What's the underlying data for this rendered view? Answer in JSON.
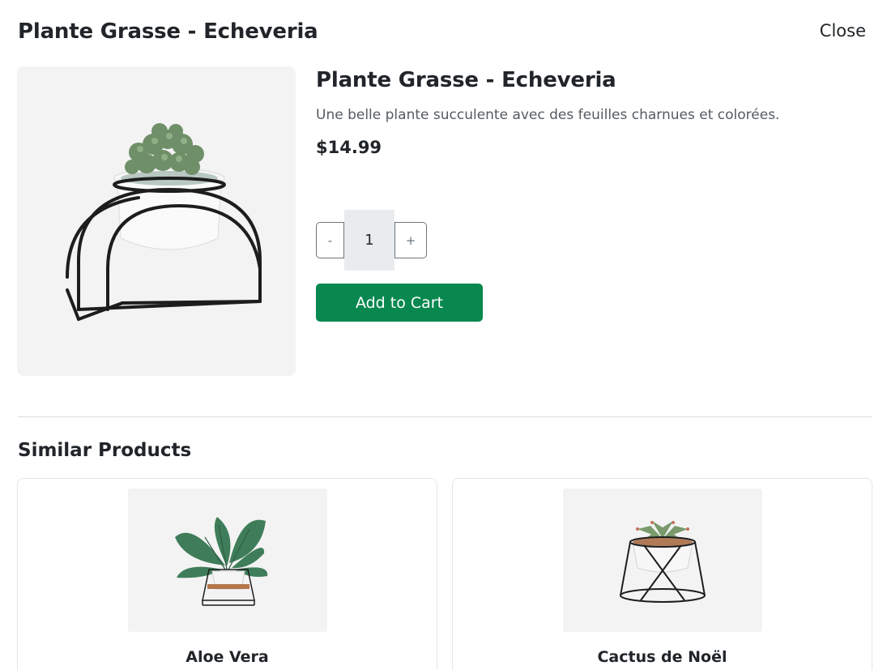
{
  "modal": {
    "title": "Plante Grasse - Echeveria",
    "close_label": "Close"
  },
  "product": {
    "name": "Plante Grasse - Echeveria",
    "description": "Une belle plante succulente avec des feuilles charnues et colorées.",
    "price": "$14.99",
    "image_icon": "succulent-in-pot-with-black-arch-stand"
  },
  "quantity": {
    "minus_label": "-",
    "value": "1",
    "plus_label": "+"
  },
  "add_to_cart_label": "Add to Cart",
  "similar": {
    "title": "Similar Products",
    "items": [
      {
        "name": "Aloe Vera",
        "image_icon": "leafy-plant-in-pot-with-wire-frame"
      },
      {
        "name": "Cactus de Noël",
        "image_icon": "succulent-in-pot-with-wire-stand"
      }
    ]
  },
  "colors": {
    "accent": "#08884f",
    "image_bg": "#f3f3f3",
    "qty_bg": "#e9ecef"
  }
}
